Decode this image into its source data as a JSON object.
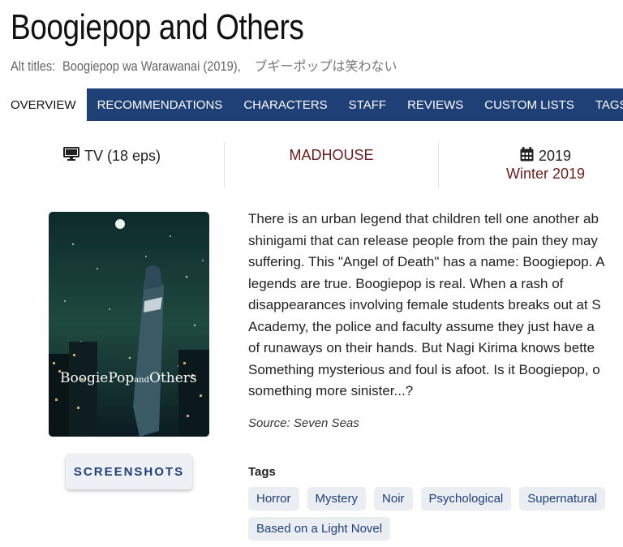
{
  "header": {
    "title": "Boogiepop and Others",
    "alt_label": "Alt titles:",
    "alt_en": "Boogiepop wa Warawanai (2019),",
    "alt_jp": "ブギーポップは笑わない"
  },
  "nav": {
    "tabs": [
      {
        "label": "OVERVIEW",
        "active": true
      },
      {
        "label": "RECOMMENDATIONS"
      },
      {
        "label": "CHARACTERS"
      },
      {
        "label": "STAFF"
      },
      {
        "label": "REVIEWS"
      },
      {
        "label": "CUSTOM LISTS"
      },
      {
        "label": "TAGS"
      }
    ]
  },
  "info": {
    "format": "TV (18 eps)",
    "studio": "MADHOUSE",
    "year": "2019",
    "season": "Winter 2019"
  },
  "poster": {
    "title_text": "BoogiePop and Others"
  },
  "screenshots_label": "SCREENSHOTS",
  "synopsis": {
    "lines": [
      "There is an urban legend that children tell one another ab",
      "shinigami that can release people from the pain they may",
      "suffering. This \"Angel of Death\" has a name: Boogiepop. A",
      "legends are true. Boogiepop is real. When a rash of",
      "disappearances involving female students breaks out at S",
      "Academy, the police and faculty assume they just have a",
      "of runaways on their hands. But Nagi Kirima knows bette",
      "Something mysterious and foul is afoot. Is it Boogiepop, o",
      "something more sinister...?"
    ],
    "source": "Source: Seven Seas"
  },
  "tags": {
    "heading": "Tags",
    "items": [
      "Horror",
      "Mystery",
      "Noir",
      "Psychological",
      "Supernatural",
      "Based on a Light Novel"
    ]
  },
  "colors": {
    "nav_bg": "#1f3f77",
    "studio": "#6e1b1b",
    "tag_bg": "#eaedf2"
  }
}
